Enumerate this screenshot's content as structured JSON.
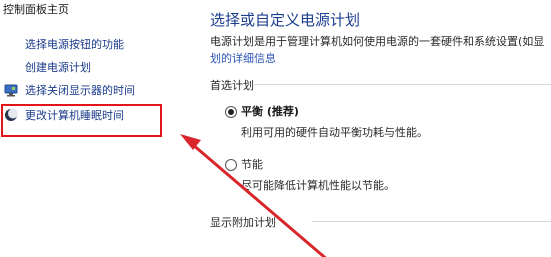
{
  "sidebar": {
    "home": "控制面板主页",
    "links": [
      {
        "label": "选择电源按钮的功能",
        "icon": null
      },
      {
        "label": "创建电源计划",
        "icon": null
      },
      {
        "label": "选择关闭显示器的时间",
        "icon": "monitor-power-icon"
      },
      {
        "label": "更改计算机睡眠时间",
        "icon": "moon-sleep-icon"
      }
    ]
  },
  "main": {
    "title": "选择或自定义电源计划",
    "description_line1": "电源计划是用于管理计算机如何使用电源的一套硬件和系统设置(如显",
    "description_line2": "划的详细信息",
    "preferred_section": "首选计划",
    "plans": [
      {
        "name": "平衡 (推荐)",
        "description": "利用可用的硬件自动平衡功耗与性能。",
        "selected": true
      },
      {
        "name": "节能",
        "description": "尽可能降低计算机性能以节能。",
        "selected": false
      }
    ],
    "additional_section": "显示附加计划"
  },
  "colors": {
    "highlight_border": "#e2161a",
    "arrow": "#d9262b",
    "title": "#1b3f8f",
    "link": "#1a3a8a"
  }
}
